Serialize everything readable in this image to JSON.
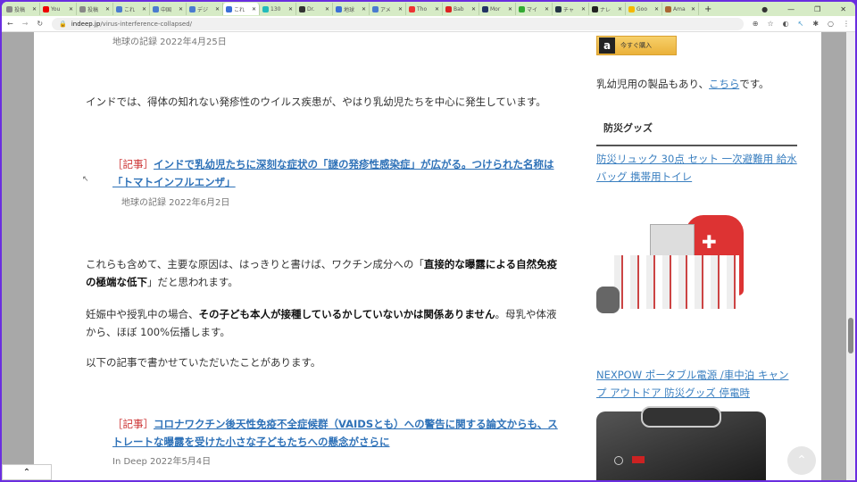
{
  "browser": {
    "tabs": [
      {
        "label": "投稿",
        "color": "#888"
      },
      {
        "label": "You",
        "color": "#e00"
      },
      {
        "label": "投稿",
        "color": "#888"
      },
      {
        "label": "これ",
        "color": "#4a7bd0"
      },
      {
        "label": "中国",
        "color": "#4a7bd0"
      },
      {
        "label": "デジ",
        "color": "#4a7bd0"
      },
      {
        "label": "これ",
        "color": "#3a6fd8",
        "active": true
      },
      {
        "label": "130",
        "color": "#2bb"
      },
      {
        "label": "Dr.",
        "color": "#333"
      },
      {
        "label": "地球",
        "color": "#3a6fd8"
      },
      {
        "label": "アメ",
        "color": "#4a7bd0"
      },
      {
        "label": "Tho",
        "color": "#e33"
      },
      {
        "label": "Bab",
        "color": "#d22"
      },
      {
        "label": "Mor",
        "color": "#236"
      },
      {
        "label": "マイ",
        "color": "#3a3"
      },
      {
        "label": "チャ",
        "color": "#234"
      },
      {
        "label": "ナレ",
        "color": "#222"
      },
      {
        "label": "Goo",
        "color": "#f5b800"
      },
      {
        "label": "Ama",
        "color": "#a63"
      }
    ],
    "new_tab": "+",
    "url_domain": "indeep.jp",
    "url_path": "/virus-interference-collapsed/"
  },
  "main": {
    "meta1": "地球の記録 2022年4月25日",
    "p1": "インドでは、得体の知れない発疹性のウイルス疾患が、やはり乳幼児たちを中心に発生しています。",
    "tag": "［記事］",
    "link1": "インドで乳幼児たちに深刻な症状の「謎の発疹性感染症」が広がる。つけられた名称は「トマトインフルエンザ」",
    "meta2": "地球の記録 2022年6月2日",
    "p2a": "これらも含めて、主要な原因は、はっきりと書けば、ワクチン成分への「",
    "p2b": "直接的な曝露による自然免疫の極端な低下",
    "p2c": "」だと思われます。",
    "p3a": "妊娠中や授乳中の場合、",
    "p3b": "その子ども本人が接種しているかしていないかは関係ありません",
    "p3c": "。母乳や体液から、ほぼ 100%伝播します。",
    "p4": "以下の記事で書かせていただいたことがあります。",
    "link2": "コロナワクチン後天性免疫不全症候群（VAIDSとも）への警告に関する論文からも、ストレートな曝露を受けた小さな子どもたちへの懸念がさらに",
    "meta3": "In Deep 2022年5月4日"
  },
  "side": {
    "amazon_button": "今すぐ購入",
    "note_a": "乳幼児用の製品もあり、",
    "note_link": "こちら",
    "note_b": "です。",
    "heading": "防災グッズ",
    "product1": "防災リュック 30点 セット 一次避難用 給水バッグ 携帯用トイレ",
    "product2": "NEXPOW ポータブル電源 /車中泊 キャンプ アウトドア 防災グッズ 停電時"
  }
}
